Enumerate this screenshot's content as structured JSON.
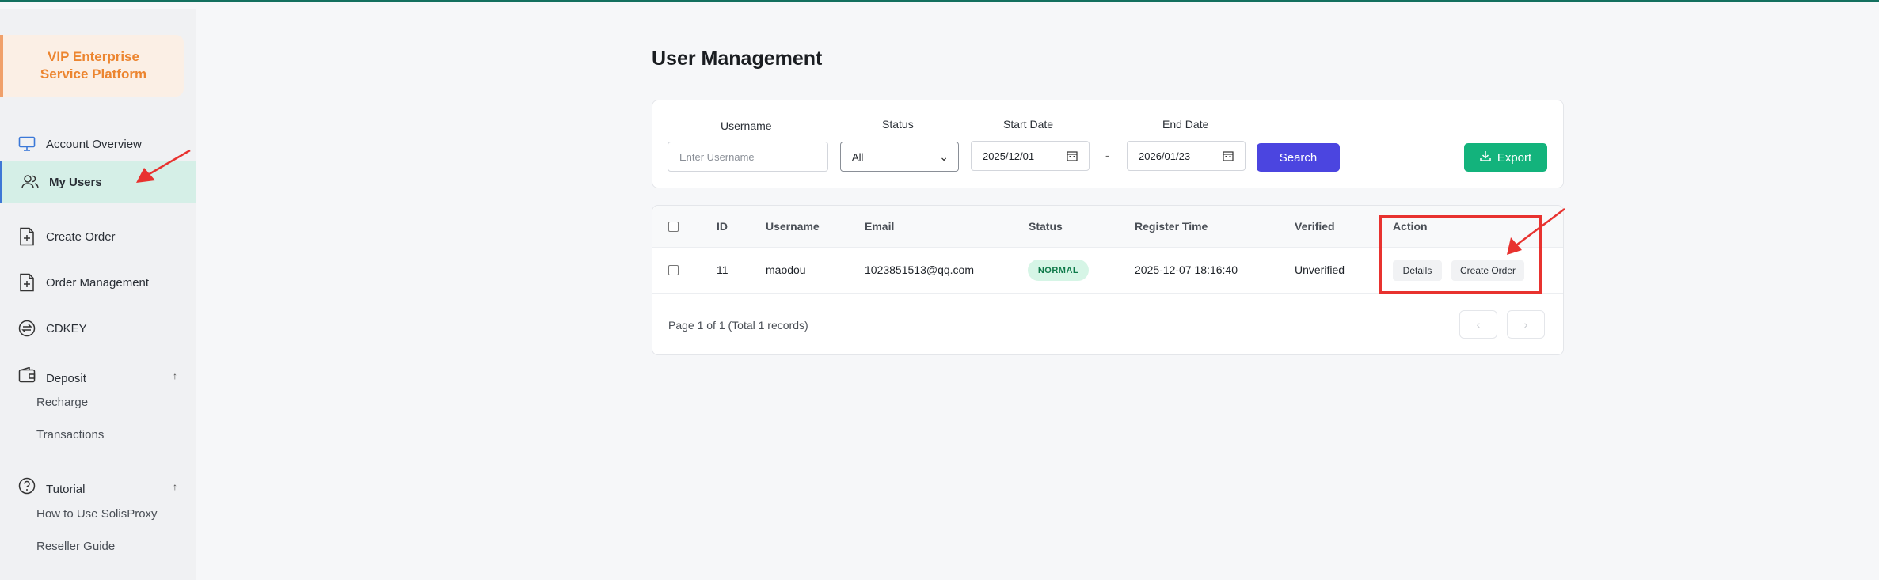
{
  "brand": {
    "title": "VIP Enterprise Service Platform"
  },
  "sidebar": {
    "items": [
      {
        "label": "Account Overview",
        "icon": "monitor-icon"
      },
      {
        "label": "My Users",
        "icon": "users-icon",
        "active": true
      },
      {
        "label": "Create Order",
        "icon": "file-plus-icon"
      },
      {
        "label": "Order Management",
        "icon": "file-plus-icon"
      },
      {
        "label": "CDKEY",
        "icon": "exchange-icon"
      },
      {
        "label": "Deposit",
        "icon": "wallet-icon",
        "caret": "↑"
      },
      {
        "label": "Tutorial",
        "icon": "help-circle-icon",
        "caret": "↑"
      }
    ],
    "deposit_sub": [
      "Recharge",
      "Transactions"
    ],
    "tutorial_sub": [
      "How to Use SolisProxy",
      "Reseller Guide"
    ]
  },
  "page": {
    "title": "User Management"
  },
  "filters": {
    "username_label": "Username",
    "username_placeholder": "Enter Username",
    "status_label": "Status",
    "status_value": "All",
    "start_label": "Start Date",
    "start_value": "2025/12/01",
    "end_label": "End Date",
    "end_value": "2026/01/23",
    "separator": "-",
    "search_label": "Search",
    "export_label": "Export"
  },
  "table": {
    "headers": [
      "ID",
      "Username",
      "Email",
      "Status",
      "Register Time",
      "Verified",
      "Action"
    ],
    "rows": [
      {
        "id": "11",
        "username": "maodou",
        "email": "1023851513@qq.com",
        "status": "NORMAL",
        "register_time": "2025-12-07 18:16:40",
        "verified": "Unverified",
        "actions": [
          "Details",
          "Create Order"
        ]
      }
    ],
    "pagination": "Page 1 of 1 (Total 1 records)",
    "prev": "‹",
    "next": "›"
  },
  "colors": {
    "brand_text": "#ec8530",
    "primary": "#4b45e0",
    "export": "#13b37c",
    "active_nav": "#d5efe7",
    "annotation": "#e8322f"
  }
}
